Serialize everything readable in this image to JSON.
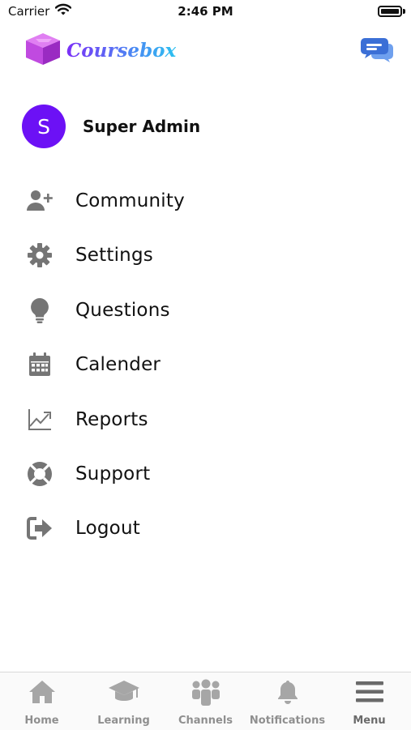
{
  "status_bar": {
    "carrier": "Carrier",
    "time": "2:46 PM",
    "icons": [
      "wifi-icon",
      "battery-icon"
    ]
  },
  "header": {
    "logo_text": "Coursebox",
    "logo_icon": "cube-logo-icon",
    "chat_icon": "chat-bubbles-icon",
    "colors": {
      "logo_cube": "#c04ae0",
      "logo_gradient_start": "#7b2ff7",
      "logo_gradient_end": "#2cc1f0",
      "chat_icon": "#3b6fd6"
    }
  },
  "profile": {
    "avatar_letter": "S",
    "name": "Super Admin",
    "avatar_color": "#6c11f5"
  },
  "menu": {
    "items": [
      {
        "label": "Community",
        "icon": "add-user-icon"
      },
      {
        "label": "Settings",
        "icon": "gear-icon"
      },
      {
        "label": "Questions",
        "icon": "lightbulb-icon"
      },
      {
        "label": "Calender",
        "icon": "calendar-icon"
      },
      {
        "label": "Reports",
        "icon": "line-chart-icon"
      },
      {
        "label": "Support",
        "icon": "lifebuoy-icon"
      },
      {
        "label": "Logout",
        "icon": "logout-icon"
      }
    ],
    "icon_color": "#757575"
  },
  "tabbar": {
    "items": [
      {
        "label": "Home",
        "icon": "home-icon"
      },
      {
        "label": "Learning",
        "icon": "graduation-cap-icon"
      },
      {
        "label": "Channels",
        "icon": "group-icon"
      },
      {
        "label": "Notifications",
        "icon": "bell-icon"
      },
      {
        "label": "Menu",
        "icon": "hamburger-menu-icon",
        "active": true
      }
    ],
    "inactive_color": "#a6a6a6",
    "active_color": "#6a6a6a"
  }
}
